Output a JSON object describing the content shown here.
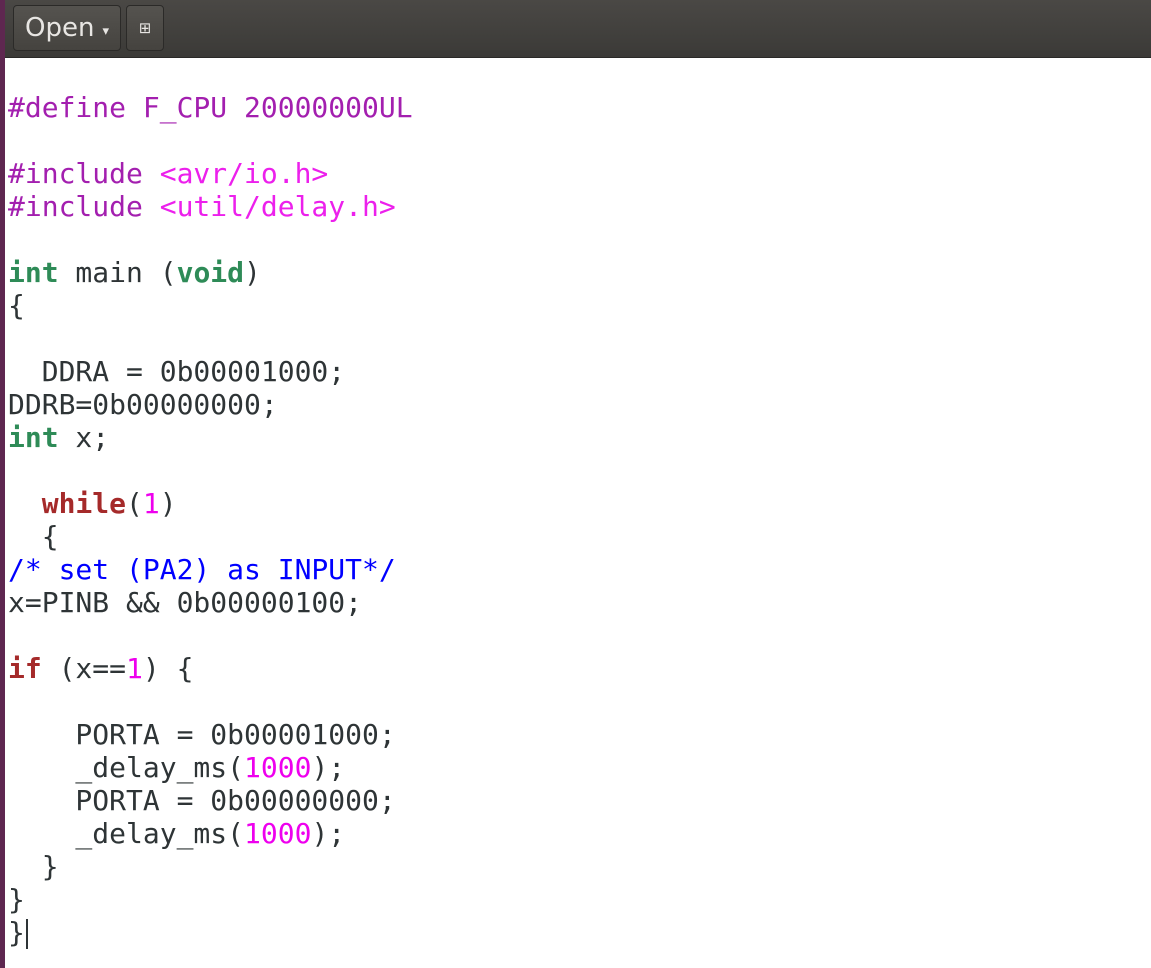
{
  "header": {
    "open_label": "Open",
    "open_chevron": "▾",
    "pin_icon": "⊞"
  },
  "code": {
    "l1": "#define F_CPU 20000000UL",
    "l3a": "#include ",
    "l3b": "<avr/io.h>",
    "l4a": "#include ",
    "l4b": "<util/delay.h>",
    "l6_kw": "int",
    "l6_mid": " main (",
    "l6_kw2": "void",
    "l6_end": ")",
    "l7": "{",
    "l9": "  DDRA = 0b00001000;",
    "l10": "DDRB=0b00000000;",
    "l11_kw": "int",
    "l11_rest": " x;",
    "l13_indent": "  ",
    "l13_kw": "while",
    "l13_open": "(",
    "l13_num": "1",
    "l13_close": ")",
    "l14": "  {",
    "l15": "/* set (PA2) as INPUT*/",
    "l16": "x=PINB && 0b00000100;",
    "l18_kw": "if",
    "l18_mid": " (x==",
    "l18_num": "1",
    "l18_end": ") {",
    "l20": "    PORTA = 0b00001000;",
    "l21a": "    _delay_ms(",
    "l21_num": "1000",
    "l21b": ");",
    "l22": "    PORTA = 0b00000000;",
    "l23a": "    _delay_ms(",
    "l23_num": "1000",
    "l23b": ");",
    "l24": "  }",
    "l25": "}",
    "l26": "}"
  },
  "colors": {
    "titlebar": "#3b3a37",
    "preprocessor": "#a31faf",
    "include_path": "#ec20ec",
    "type_keyword": "#2e8b57",
    "control_keyword": "#a52a2a",
    "number": "#ee00ee",
    "comment": "#0000ff"
  }
}
